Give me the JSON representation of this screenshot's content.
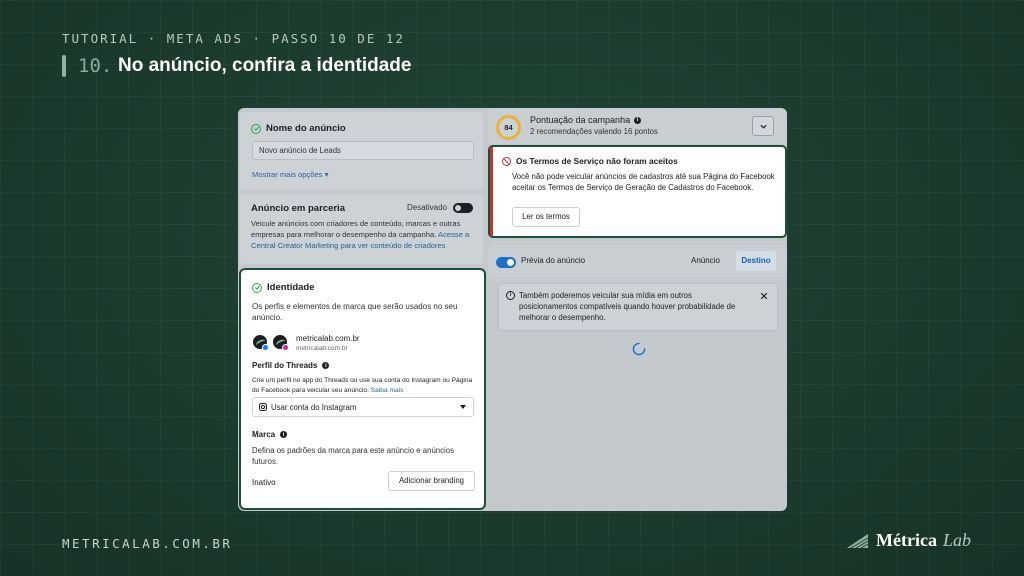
{
  "header": {
    "breadcrumb": "TUTORIAL · META ADS · PASSO 10 DE 12",
    "step_number": "10.",
    "step_title": "No anúncio, confira a identidade"
  },
  "footer": {
    "url": "METRICALAB.COM.BR",
    "brand_name": "Métrica",
    "brand_sub": "Lab"
  },
  "ad_name": {
    "title": "Nome do anúncio",
    "value": "Novo anúncio de Leads",
    "more_options": "Mostrar mais opções ▾"
  },
  "partnership": {
    "title": "Anúncio em parceria",
    "toggle_label": "Desativado",
    "description": "Veicule anúncios com criadores de conteúdo, marcas e outras empresas para melhorar o desempenho da campanha.",
    "link": "Acesse a Central Creator Marketing para ver conteúdo de criadores"
  },
  "identity": {
    "title": "Identidade",
    "description": "Os perfis e elementos de marca que serão usados no seu anúncio.",
    "account_name": "metricalab.com.br",
    "account_handle": "metricalab.com.br",
    "threads_title": "Perfil do Threads",
    "threads_desc": "Crie um perfil no app do Threads ou use sua conta do Instagram ou Página do Facebook para veicular seu anúncio.",
    "threads_link": "Saiba mais",
    "threads_select": "Usar conta do Instagram",
    "brand_title": "Marca",
    "brand_desc": "Defina os padrões da marca para este anúncio e anúncios futuros.",
    "brand_status": "Inativo",
    "brand_button": "Adicionar branding"
  },
  "score": {
    "value": "84",
    "title": "Pontuação da campanha",
    "subtitle": "2 recomendações valendo 16 pontos"
  },
  "terms": {
    "title": "Os Termos de Serviço não foram aceitos",
    "body": "Você não pode veicular anúncios de cadastros até sua Página do Facebook aceitar os Termos de Serviço de Geração de Cadastros do Facebook.",
    "button": "Ler os termos"
  },
  "preview": {
    "label": "Prévia do anúncio",
    "tab_ad": "Anúncio",
    "tab_destination": "Destino",
    "notice": "Também poderemos veicular sua mídia em outros posicionamentos compatíveis quando houver probabilidade de melhorar o desempenho."
  },
  "colors": {
    "background": "#1b3a2e",
    "highlight_border": "#1f4d3a",
    "error": "#c8312e",
    "toggle_on": "#1c6fc9",
    "score_ring": "#e8b33a"
  }
}
